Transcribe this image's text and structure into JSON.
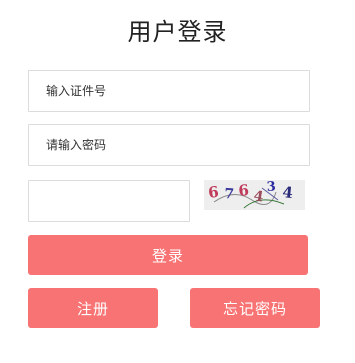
{
  "title": "用户登录",
  "form": {
    "account_placeholder": "输入证件号",
    "account_value": "",
    "password_placeholder": "请输入密码",
    "password_value": "",
    "captcha_placeholder": "",
    "captcha_value": ""
  },
  "captcha": {
    "characters": [
      "6",
      "7",
      "6",
      "4",
      "3",
      "4"
    ],
    "colors": [
      "#c03a5a",
      "#3a3a9a",
      "#c03a5a",
      "#9a4a5a",
      "#2a2aa0",
      "#2a2a7a"
    ]
  },
  "buttons": {
    "login": "登录",
    "register": "注册",
    "forgot": "忘记密码"
  },
  "colors": {
    "primary": "#f87373",
    "border": "#dcdcdc"
  }
}
